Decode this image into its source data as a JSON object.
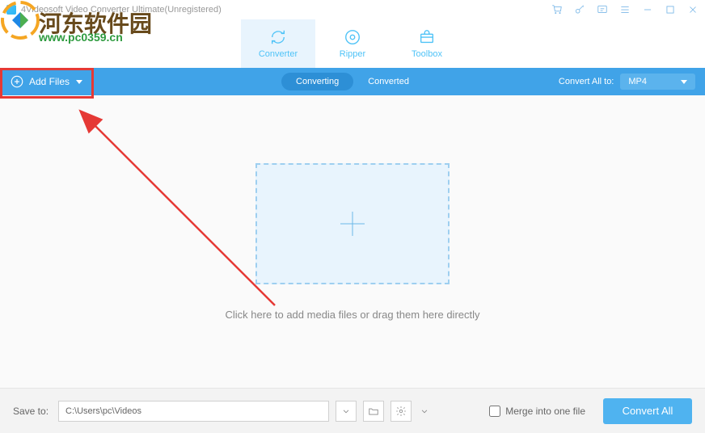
{
  "titlebar": {
    "title": "4Videosoft Video Converter Ultimate(Unregistered)"
  },
  "tabs": {
    "converter": "Converter",
    "ripper": "Ripper",
    "toolbox": "Toolbox"
  },
  "actionbar": {
    "add_files": "Add Files",
    "converting": "Converting",
    "converted": "Converted",
    "convert_all_to": "Convert All to:",
    "format": "MP4"
  },
  "main": {
    "drop_text": "Click here to add media files or drag them here directly"
  },
  "bottombar": {
    "save_to": "Save to:",
    "path": "C:\\Users\\pc\\Videos",
    "merge": "Merge into one file",
    "convert_all": "Convert All"
  },
  "watermark": {
    "text1": "河东软件园",
    "text2": "www.pc0359.cn"
  }
}
